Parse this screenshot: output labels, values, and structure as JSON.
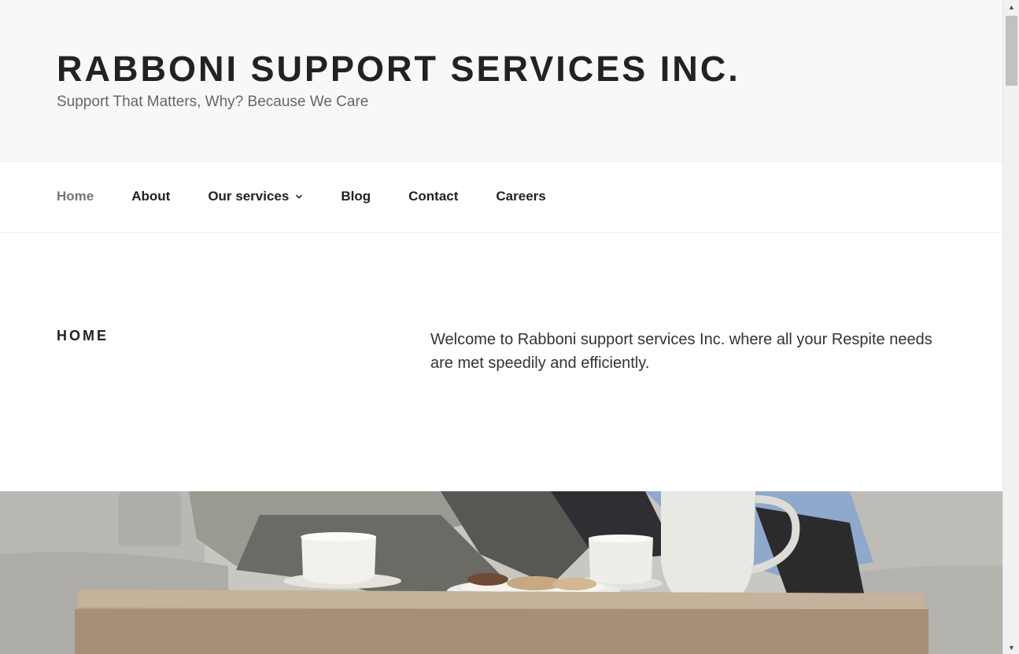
{
  "site": {
    "title": "RABBONI SUPPORT SERVICES INC.",
    "tagline": "Support That Matters, Why? Because We Care"
  },
  "nav": {
    "items": [
      {
        "label": "Home",
        "current": true
      },
      {
        "label": "About"
      },
      {
        "label": "Our services",
        "has_submenu": true
      },
      {
        "label": "Blog"
      },
      {
        "label": "Contact"
      },
      {
        "label": "Careers"
      }
    ]
  },
  "page": {
    "heading": "HOME",
    "body": "Welcome to Rabboni support services Inc. where all your Respite needs are met speedily and efficiently."
  },
  "hero": {
    "icon": "photo-coffee-table-with-cups"
  },
  "colors": {
    "header_bg": "#f8f8f8",
    "text_dark": "#222222",
    "text_muted": "#666666",
    "nav_current": "#767676"
  }
}
